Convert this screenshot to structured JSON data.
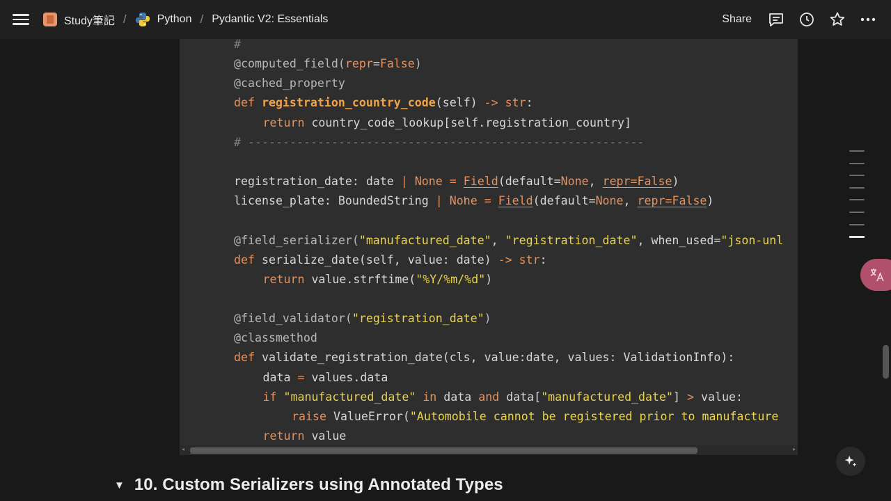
{
  "breadcrumb": {
    "items": [
      "Study筆記",
      "Python",
      "Pydantic V2: Essentials"
    ],
    "separator": "/"
  },
  "header": {
    "share_label": "Share"
  },
  "icons": {
    "menu": "hamburger-menu-icon",
    "notebook": "notebook-icon",
    "python": "python-logo-icon",
    "comments": "comment-icon",
    "history": "clock-icon",
    "favorite": "star-icon",
    "more": "more-horizontal-icon",
    "translate": "translate-icon",
    "ai": "sparkle-icon"
  },
  "code": {
    "lines": [
      {
        "indent": 0,
        "tokens": [
          [
            "cmt",
            "#"
          ]
        ]
      },
      {
        "indent": 0,
        "tokens": [
          [
            "dec",
            "@computed_field("
          ],
          [
            "kw",
            "repr"
          ],
          [
            "",
            "="
          ],
          [
            "kw",
            "False"
          ],
          [
            "dec",
            ")"
          ]
        ]
      },
      {
        "indent": 0,
        "tokens": [
          [
            "dec",
            "@cached_property"
          ]
        ]
      },
      {
        "indent": 0,
        "tokens": [
          [
            "kw",
            "def "
          ],
          [
            "fn",
            "registration_country_code"
          ],
          [
            "",
            "(self) "
          ],
          [
            "kw",
            "->"
          ],
          [
            "",
            " "
          ],
          [
            "kw",
            "str"
          ],
          [
            "",
            ":"
          ]
        ]
      },
      {
        "indent": 1,
        "tokens": [
          [
            "kw",
            "return "
          ],
          [
            "",
            "country_code_lookup[self.registration_country]"
          ]
        ]
      },
      {
        "indent": 0,
        "tokens": [
          [
            "cmt",
            "# ---------------------------------------------------------"
          ]
        ]
      },
      {
        "indent": 0,
        "tokens": []
      },
      {
        "indent": 0,
        "tokens": [
          [
            "",
            "registration_date: date "
          ],
          [
            "kw",
            "|"
          ],
          [
            "",
            " "
          ],
          [
            "nonec",
            "None"
          ],
          [
            "",
            " "
          ],
          [
            "kw",
            "="
          ],
          [
            "",
            " "
          ],
          [
            "cls",
            "Field"
          ],
          [
            "",
            "(default="
          ],
          [
            "nonec",
            "None"
          ],
          [
            "",
            ", "
          ],
          [
            "kwarg",
            "repr=False"
          ],
          [
            "",
            ")"
          ]
        ]
      },
      {
        "indent": 0,
        "tokens": [
          [
            "",
            "license_plate: BoundedString "
          ],
          [
            "kw",
            "|"
          ],
          [
            "",
            " "
          ],
          [
            "nonec",
            "None"
          ],
          [
            "",
            " "
          ],
          [
            "kw",
            "="
          ],
          [
            "",
            " "
          ],
          [
            "cls",
            "Field"
          ],
          [
            "",
            "(default="
          ],
          [
            "nonec",
            "None"
          ],
          [
            "",
            ", "
          ],
          [
            "kwarg",
            "repr=False"
          ],
          [
            "",
            ")"
          ]
        ]
      },
      {
        "indent": 0,
        "tokens": []
      },
      {
        "indent": 0,
        "tokens": [
          [
            "dec",
            "@field_serializer("
          ],
          [
            "str",
            "\"manufactured_date\""
          ],
          [
            "",
            ", "
          ],
          [
            "str",
            "\"registration_date\""
          ],
          [
            "",
            ", when_used="
          ],
          [
            "str",
            "\"json-unl"
          ]
        ]
      },
      {
        "indent": 0,
        "tokens": [
          [
            "kw",
            "def "
          ],
          [
            "",
            "serialize_date(self, value: date) "
          ],
          [
            "kw",
            "->"
          ],
          [
            "",
            " "
          ],
          [
            "kw",
            "str"
          ],
          [
            "",
            ":"
          ]
        ]
      },
      {
        "indent": 1,
        "tokens": [
          [
            "kw",
            "return "
          ],
          [
            "",
            "value.strftime("
          ],
          [
            "str",
            "\"%Y/%m/%d\""
          ],
          [
            "",
            ")"
          ]
        ]
      },
      {
        "indent": 0,
        "tokens": []
      },
      {
        "indent": 0,
        "tokens": [
          [
            "dec",
            "@field_validator("
          ],
          [
            "str",
            "\"registration_date\""
          ],
          [
            "dec",
            ")"
          ]
        ]
      },
      {
        "indent": 0,
        "tokens": [
          [
            "dec",
            "@classmethod"
          ]
        ]
      },
      {
        "indent": 0,
        "tokens": [
          [
            "kw",
            "def "
          ],
          [
            "",
            "validate_registration_date(cls, value:date, values: ValidationInfo):"
          ]
        ]
      },
      {
        "indent": 1,
        "tokens": [
          [
            "",
            "data "
          ],
          [
            "kw",
            "="
          ],
          [
            "",
            " values.data"
          ]
        ]
      },
      {
        "indent": 1,
        "tokens": [
          [
            "kw",
            "if "
          ],
          [
            "str",
            "\"manufactured_date\""
          ],
          [
            "",
            " "
          ],
          [
            "kw",
            "in"
          ],
          [
            "",
            " data "
          ],
          [
            "kw",
            "and"
          ],
          [
            "",
            " data["
          ],
          [
            "str",
            "\"manufactured_date\""
          ],
          [
            "",
            "] "
          ],
          [
            "kw",
            ">"
          ],
          [
            "",
            " value:"
          ]
        ]
      },
      {
        "indent": 2,
        "tokens": [
          [
            "kw",
            "raise "
          ],
          [
            "",
            "ValueError("
          ],
          [
            "str",
            "\"Automobile cannot be registered prior to manufacture"
          ]
        ]
      },
      {
        "indent": 1,
        "tokens": [
          [
            "kw",
            "return "
          ],
          [
            "",
            "value"
          ]
        ]
      }
    ]
  },
  "section": {
    "title": "10. Custom Serializers using Annotated Types"
  },
  "colors": {
    "background": "#191919",
    "code_background": "#2e2e2e",
    "keyword": "#e8915a",
    "string": "#e9d44b",
    "comment": "#808080",
    "translate_button": "#b0506c"
  }
}
